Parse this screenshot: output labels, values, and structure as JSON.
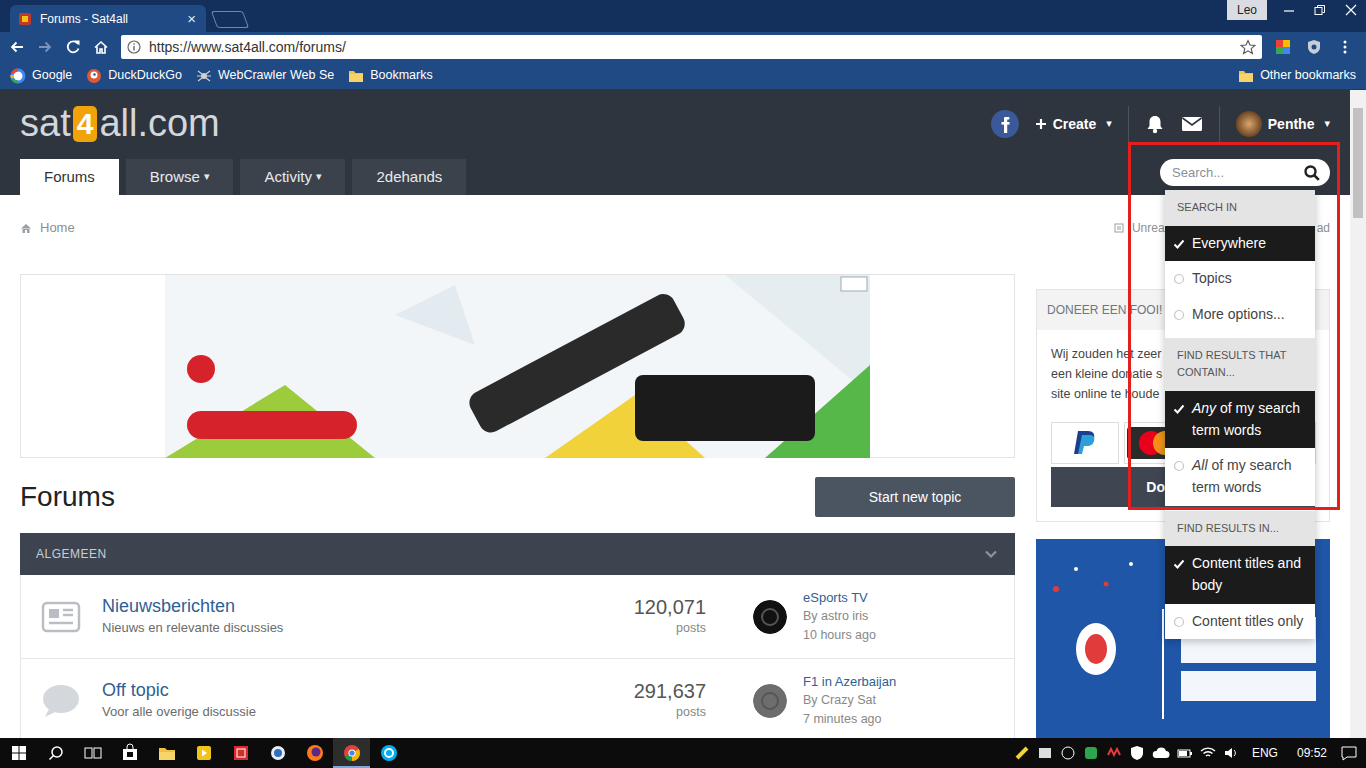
{
  "window": {
    "tab_title": "Forums - Sat4all",
    "tab_close": "×",
    "profile": "Leo"
  },
  "browser": {
    "back_enabled": true,
    "forward_enabled": false,
    "url": "https://www.sat4all.com/forums/",
    "bookmarks": [
      {
        "label": "Google"
      },
      {
        "label": "DuckDuckGo"
      },
      {
        "label": "WebCrawler Web Se"
      },
      {
        "label": "Bookmarks"
      }
    ],
    "other_bookmarks": "Other bookmarks"
  },
  "site": {
    "logo": {
      "left": "sat",
      "mid": "4",
      "right": "all.com"
    },
    "create": {
      "label": "Create",
      "caret": "▾"
    },
    "user": {
      "label": "Penthe",
      "caret": "▾"
    },
    "nav": [
      {
        "label": "Forums",
        "selected": true
      },
      {
        "label": "Browse",
        "caret": "▾",
        "selected": false
      },
      {
        "label": "Activity",
        "caret": "▾",
        "selected": false
      },
      {
        "label": "2dehands",
        "selected": false
      }
    ],
    "search": {
      "placeholder": "Search..."
    }
  },
  "breadcrumb": {
    "home": "Home",
    "links": [
      "Unrea",
      "ad"
    ]
  },
  "search_menu": {
    "sections": [
      {
        "heading": "SEARCH IN",
        "options": [
          {
            "label": "Everywhere",
            "checked": true
          },
          {
            "label": "Topics",
            "checked": false
          },
          {
            "label": "More options...",
            "checked": false
          }
        ]
      },
      {
        "heading": "FIND RESULTS THAT CONTAIN...",
        "options": [
          {
            "lead": "Any",
            "label": " of my search term words",
            "checked": true
          },
          {
            "lead": "All",
            "label": " of my search term words",
            "checked": false
          }
        ]
      },
      {
        "heading": "FIND RESULTS IN...",
        "options": [
          {
            "label": "Content titles and body",
            "checked": true
          },
          {
            "label": "Content titles only",
            "checked": false
          }
        ]
      }
    ]
  },
  "forums": {
    "heading": "Forums",
    "new_topic": "Start new topic",
    "category": {
      "title": "ALGEMEEN",
      "expanded": true
    },
    "rows": [
      {
        "title": "Nieuwsberichten",
        "description": "Nieuws en relevante discussies",
        "count": "120,071",
        "count_label": "posts",
        "last_title": "eSports TV",
        "last_by": "By astro iris",
        "last_time": "10 hours ago"
      },
      {
        "title": "Off topic",
        "description": "Voor alle overige discussie",
        "count": "291,637",
        "count_label": "posts",
        "last_title": "F1 in Azerbaijan",
        "last_by": "By Crazy Sat",
        "last_time": "7 minutes ago"
      }
    ]
  },
  "sidebar": {
    "donate": {
      "title": "DONEER EEN FOOI!",
      "lines": [
        "Wij zouden het zeer",
        "een kleine donatie s",
        "site online te houde"
      ],
      "button": "Do"
    }
  },
  "taskbar": {
    "apps": [
      {
        "selected": false
      },
      {
        "selected": false
      },
      {
        "selected": false
      },
      {
        "selected": false
      },
      {
        "selected": false
      },
      {
        "selected": false
      },
      {
        "selected": true
      },
      {
        "selected": false
      }
    ],
    "language": "ENG",
    "time": "09:52"
  }
}
